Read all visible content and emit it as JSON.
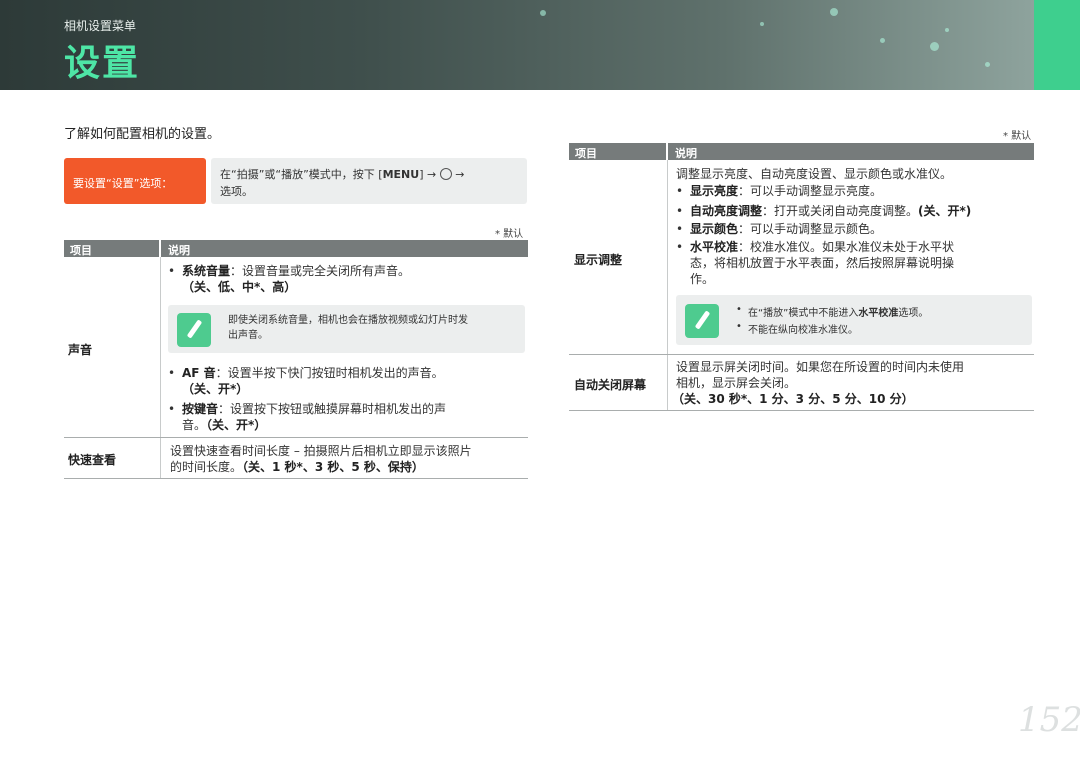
{
  "header": {
    "subtitle": "相机设置菜单",
    "title": "设置"
  },
  "intro": "了解如何配置相机的设置。",
  "setting_path": {
    "label": "要设置“设置”选项：",
    "text_line1_a": "在“拍摄”或“播放”模式中，按下 [",
    "menu_key": "MENU",
    "text_line1_b": "] → ",
    "text_line1_c": " →",
    "text_line2": "选项。"
  },
  "left_table": {
    "default_note": "* 默认",
    "headers": {
      "item": "项目",
      "desc": "说明"
    },
    "rows": {
      "sound": {
        "name": "声音",
        "b1_label": "系统音量",
        "b1_text": "：设置音量或完全关闭所有声音。",
        "b1_options": "（关、低、中*、高）",
        "note_line1": "即使关闭系统音量，相机也会在播放视频或幻灯片时发",
        "note_line2": "出声音。",
        "b2_label": "AF 音",
        "b2_text": "：设置半按下快门按钮时相机发出的声音。",
        "b2_options": "（关、开*）",
        "b3_label": "按键音",
        "b3_text": "：设置按下按钮或触摸屏幕时相机发出的声",
        "b3_text2": "音。",
        "b3_options": "（关、开*）"
      },
      "quickview": {
        "name": "快速查看",
        "line1": "设置快速查看时间长度 – 拍摄照片后相机立即显示该照片",
        "line2": "的时间长度。",
        "options": "（关、1 秒*、3 秒、5 秒、保持）"
      }
    }
  },
  "right_table": {
    "default_note": "* 默认",
    "headers": {
      "item": "项目",
      "desc": "说明"
    },
    "rows": {
      "display": {
        "name": "显示调整",
        "intro": "调整显示亮度、自动亮度设置、显示颜色或水准仪。",
        "b1_label": "显示亮度",
        "b1_text": "：可以手动调整显示亮度。",
        "b2_label": "自动亮度调整",
        "b2_text": "：打开或关闭自动亮度调整。",
        "b2_options": "(关、开*)",
        "b3_label": "显示颜色",
        "b3_text": "：可以手动调整显示颜色。",
        "b4_label": "水平校准",
        "b4_text": "：校准水准仪。如果水准仪未处于水平状",
        "b4_text2": "态，将相机放置于水平表面，然后按照屏幕说明操",
        "b4_text3": "作。",
        "note1_a": "在“播放”模式中不能进入",
        "note1_b": "水平校准",
        "note1_c": "选项。",
        "note2": "不能在纵向校准水准仪。"
      },
      "autooff": {
        "name": "自动关闭屏幕",
        "line1": "设置显示屏关闭时间。如果您在所设置的时间内未使用",
        "line2": "相机，显示屏会关闭。",
        "options": "（关、30 秒*、1 分、3 分、5 分、10 分）"
      }
    }
  },
  "page_number": "152"
}
